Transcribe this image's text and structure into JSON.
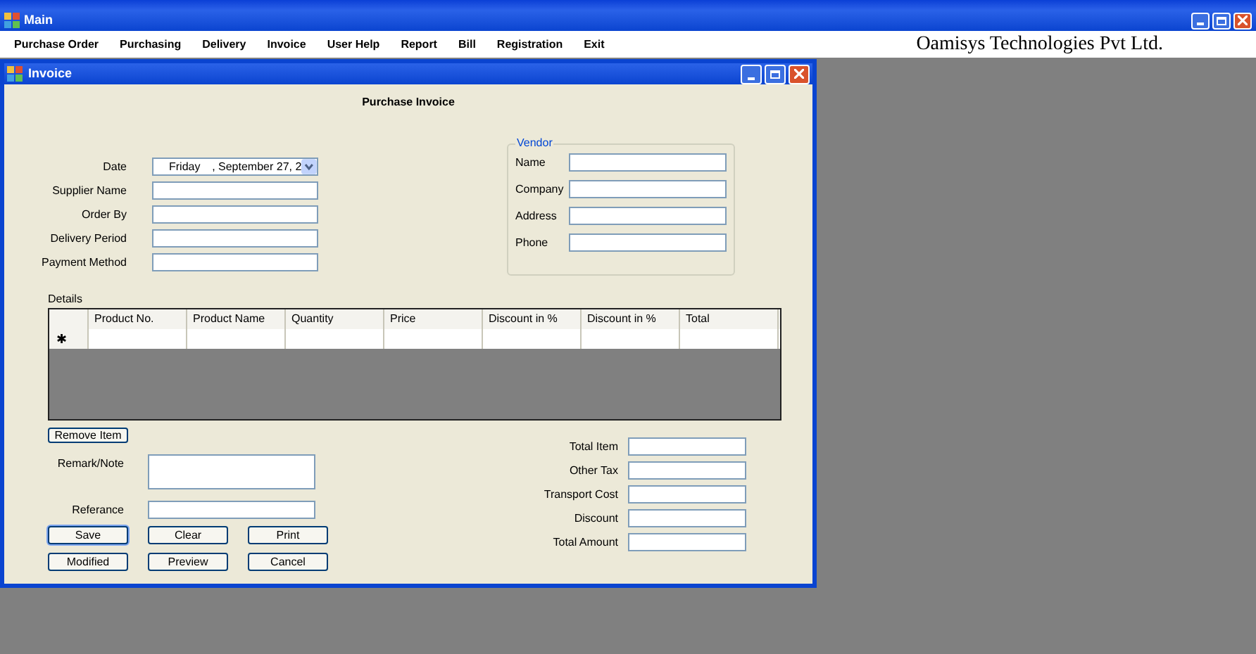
{
  "main_window": {
    "title": "Main",
    "menu": [
      {
        "label": "Purchase Order"
      },
      {
        "label": "Purchasing"
      },
      {
        "label": "Delivery"
      },
      {
        "label": "Invoice"
      },
      {
        "label": "User Help"
      },
      {
        "label": "Report"
      },
      {
        "label": "Bill"
      },
      {
        "label": "Registration"
      },
      {
        "label": "Exit"
      }
    ],
    "company": "Oamisys Technologies Pvt Ltd."
  },
  "invoice_window": {
    "title": "Invoice",
    "heading": "Purchase Invoice",
    "fields": [
      {
        "label": "Date",
        "kind": "date",
        "day": "Friday",
        "value": ", September 27, 2"
      },
      {
        "label": "Supplier Name",
        "kind": "text"
      },
      {
        "label": "Order By",
        "kind": "text"
      },
      {
        "label": "Delivery Period",
        "kind": "text"
      },
      {
        "label": "Payment Method",
        "kind": "text"
      }
    ],
    "vendor": {
      "title": "Vendor",
      "fields": [
        {
          "label": "Name"
        },
        {
          "label": "Company"
        },
        {
          "label": "Address"
        },
        {
          "label": "Phone"
        }
      ]
    },
    "details": {
      "label": "Details",
      "columns": [
        "Product No.",
        "Product Name",
        "Quantity",
        "Price",
        "Discount in %",
        "Discount in %",
        "Total"
      ],
      "new_row_marker": "✱"
    },
    "remove_button": "Remove Item",
    "remark": {
      "label": "Remark/Note"
    },
    "reference": {
      "label": "Referance"
    },
    "buttons": [
      {
        "label": "Save",
        "focused": true
      },
      {
        "label": "Clear",
        "focused": false
      },
      {
        "label": "Print",
        "focused": false
      },
      {
        "label": "Modified",
        "focused": false
      },
      {
        "label": "Preview",
        "focused": false
      },
      {
        "label": "Cancel",
        "focused": false
      }
    ],
    "totals": [
      {
        "label": "Total Item"
      },
      {
        "label": "Other Tax"
      },
      {
        "label": "Transport Cost"
      },
      {
        "label": "Discount"
      },
      {
        "label": "Total Amount"
      }
    ]
  }
}
